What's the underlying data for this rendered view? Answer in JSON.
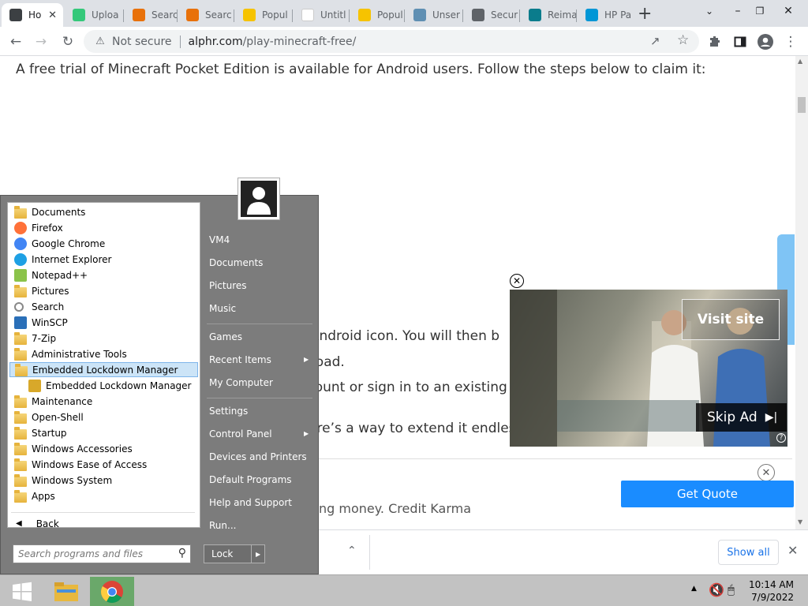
{
  "browser": {
    "tabs": [
      {
        "label": "Ho",
        "favicon_color": "#3c4043",
        "active": true
      },
      {
        "label": "Uploa",
        "favicon_color": "#34c87a"
      },
      {
        "label": "Searc",
        "favicon_color": "#e8710a"
      },
      {
        "label": "Searc",
        "favicon_color": "#e8710a"
      },
      {
        "label": "Popul",
        "favicon_color": "#f6c300"
      },
      {
        "label": "Untitl",
        "favicon_color": "#ffffff"
      },
      {
        "label": "Popul",
        "favicon_color": "#f6c300"
      },
      {
        "label": "Unser",
        "favicon_color": "#5f8fb3"
      },
      {
        "label": "Secur",
        "favicon_color": "#5f6368"
      },
      {
        "label": "Reima",
        "favicon_color": "#0a7c8c"
      },
      {
        "label": "HP Pa",
        "favicon_color": "#0096d6"
      }
    ],
    "new_tab_label": "+",
    "address": {
      "security_label": "Not secure",
      "domain": "alphr.com",
      "path": "/play-minecraft-free/"
    }
  },
  "page": {
    "intro": "A free trial of Minecraft Pocket Edition is available for Android users. Follow the steps below to claim it:",
    "step1_fragment": "ng on the Android icon. You will then b",
    "step2_fragment": "ownload.",
    "step3_fragment": "ccount or sign in to an existing acco",
    "step4_fragment": "but there’s a way to extend it endless",
    "promo_fragment": "ng money. Credit Karma",
    "get_quote": "Get Quote",
    "show_all": "Show all"
  },
  "ad": {
    "visit_site": "Visit site",
    "skip_ad": "Skip Ad"
  },
  "start_menu": {
    "programs": [
      {
        "label": "Documents",
        "icon": "documents-folder"
      },
      {
        "label": "Firefox",
        "icon": "firefox-icon"
      },
      {
        "label": "Google Chrome",
        "icon": "chrome-icon"
      },
      {
        "label": "Internet Explorer",
        "icon": "ie-icon"
      },
      {
        "label": "Notepad++",
        "icon": "notepadpp-icon"
      },
      {
        "label": "Pictures",
        "icon": "pictures-folder"
      },
      {
        "label": "Search",
        "icon": "search-icon"
      },
      {
        "label": "WinSCP",
        "icon": "winscp-icon"
      },
      {
        "label": "7-Zip",
        "icon": "folder"
      },
      {
        "label": "Administrative Tools",
        "icon": "folder"
      },
      {
        "label": "Embedded Lockdown Manager",
        "icon": "folder",
        "selected": true
      },
      {
        "label": "Embedded Lockdown Manager",
        "icon": "lock-icon",
        "indent": true
      },
      {
        "label": "Maintenance",
        "icon": "folder"
      },
      {
        "label": "Open-Shell",
        "icon": "folder"
      },
      {
        "label": "Startup",
        "icon": "folder"
      },
      {
        "label": "Windows Accessories",
        "icon": "folder"
      },
      {
        "label": "Windows Ease of Access",
        "icon": "folder"
      },
      {
        "label": "Windows System",
        "icon": "folder"
      },
      {
        "label": "Apps",
        "icon": "apps-folder"
      }
    ],
    "back": "Back",
    "search_placeholder": "Search programs and files",
    "right_links": [
      {
        "label": "VM4"
      },
      {
        "label": "Documents"
      },
      {
        "label": "Pictures"
      },
      {
        "label": "Music"
      },
      {
        "label": "Games"
      },
      {
        "label": "Recent Items",
        "submenu": true
      },
      {
        "label": "My Computer"
      },
      {
        "label": "Settings"
      },
      {
        "label": "Control Panel",
        "submenu": true
      },
      {
        "label": "Devices and Printers"
      },
      {
        "label": "Default Programs"
      },
      {
        "label": "Help and Support"
      },
      {
        "label": "Run..."
      }
    ],
    "lock": "Lock"
  },
  "taskbar": {
    "time": "10:14 AM",
    "date": "7/9/2022"
  }
}
